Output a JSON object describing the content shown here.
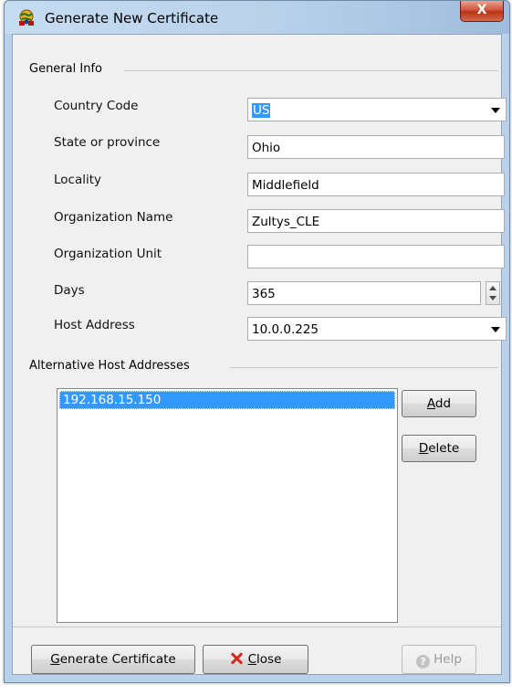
{
  "window": {
    "title": "Generate New Certificate",
    "close_glyph": "X",
    "icon": "certificate-globe-icon"
  },
  "general_info": {
    "group_label": "General Info",
    "country_code": {
      "label": "Country Code",
      "value": "US"
    },
    "state": {
      "label": "State or province",
      "value": "Ohio"
    },
    "locality": {
      "label": "Locality",
      "value": "Middlefield"
    },
    "org_name": {
      "label": "Organization Name",
      "value": "Zultys_CLE"
    },
    "org_unit": {
      "label": "Organization Unit",
      "value": ""
    },
    "days": {
      "label": "Days",
      "value": "365"
    },
    "host_address": {
      "label": "Host Address",
      "value": "10.0.0.225"
    }
  },
  "alt_hosts": {
    "group_label": "Alternative Host Addresses",
    "items": [
      "192.168.15.150"
    ],
    "add_label_prefix": "",
    "add_label_mnemonic": "A",
    "add_label_rest": "dd",
    "delete_label_mnemonic": "D",
    "delete_label_rest": "elete"
  },
  "footer": {
    "generate_mnemonic": "G",
    "generate_rest": "enerate Certificate",
    "close_mnemonic": "C",
    "close_rest": "lose",
    "help_label": "Help",
    "help_glyph": "?"
  },
  "colors": {
    "selection": "#3399ff",
    "title_bar": "#b9d1ea",
    "close_button": "#c8452a",
    "dialog_background": "#f0f0f0"
  }
}
